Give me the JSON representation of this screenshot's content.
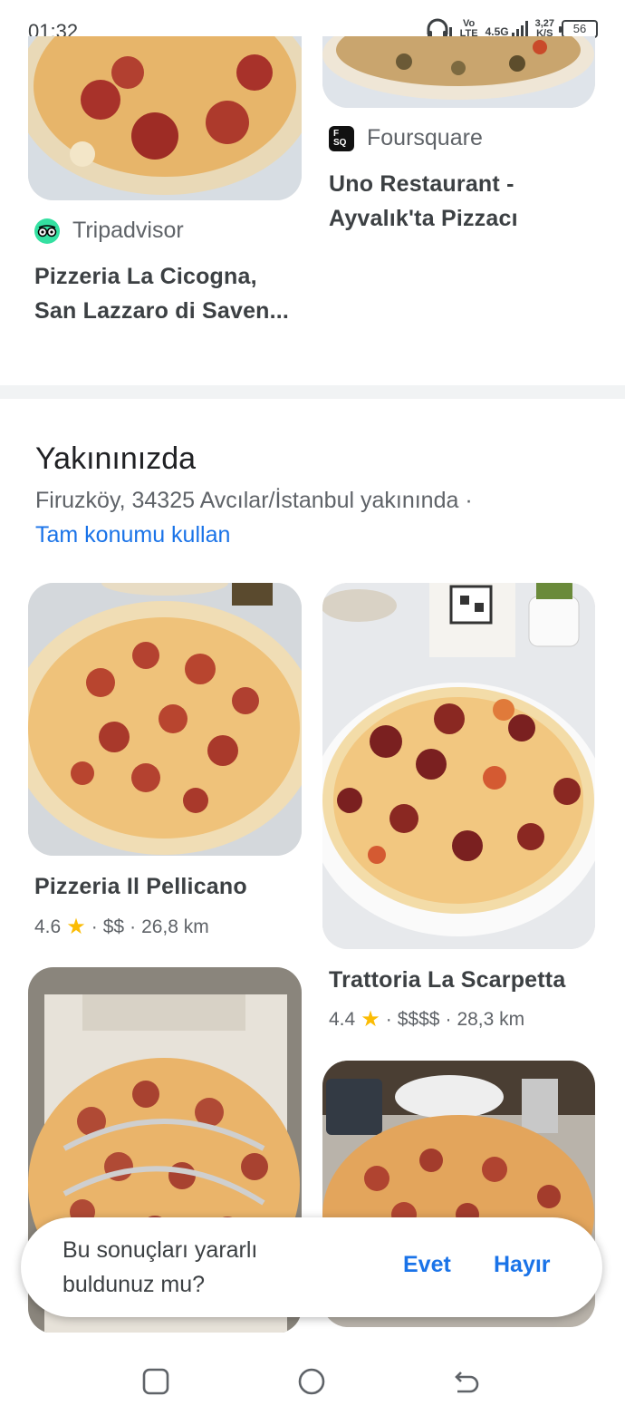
{
  "status_bar": {
    "time": "01:32",
    "volte_top": "Vo",
    "volte_bottom": "LTE",
    "network_type": "4.5G",
    "speed_value": "3,27",
    "speed_unit": "K/S",
    "battery": "56",
    "icons": [
      "headset-icon",
      "signal-icon",
      "battery-icon"
    ]
  },
  "top_cards": [
    {
      "source": "Tripadvisor",
      "source_icon": "tripadvisor-icon",
      "title_line1": "Pizzeria La Cicogna,",
      "title_line2": "San Lazzaro di Saven..."
    },
    {
      "source": "Foursquare",
      "source_icon": "foursquare-icon",
      "source_icon_text": "F SQ",
      "title_line1": "Uno Restaurant -",
      "title_line2": "Ayvalık'ta Pizzacı"
    }
  ],
  "nearby": {
    "title": "Yakınınızda",
    "location": "Firuzköy, 34325 Avcılar/İstanbul yakınında ·",
    "use_location_link": "Tam konumu kullan",
    "places": [
      {
        "name": "Pizzeria Il Pellicano",
        "rating": "4.6",
        "price": "$$",
        "distance": "26,8 km"
      },
      {
        "name": "Trattoria La Scarpetta",
        "rating": "4.4",
        "price": "$$$$",
        "distance": "28,3 km"
      }
    ],
    "separator": "·"
  },
  "feedback": {
    "question": "Bu sonuçları yararlı buldunuz mu?",
    "yes": "Evet",
    "no": "Hayır"
  },
  "colors": {
    "link_blue": "#1a73e8",
    "star_yellow": "#fbbc04",
    "tripadvisor_green": "#34e0a1"
  }
}
